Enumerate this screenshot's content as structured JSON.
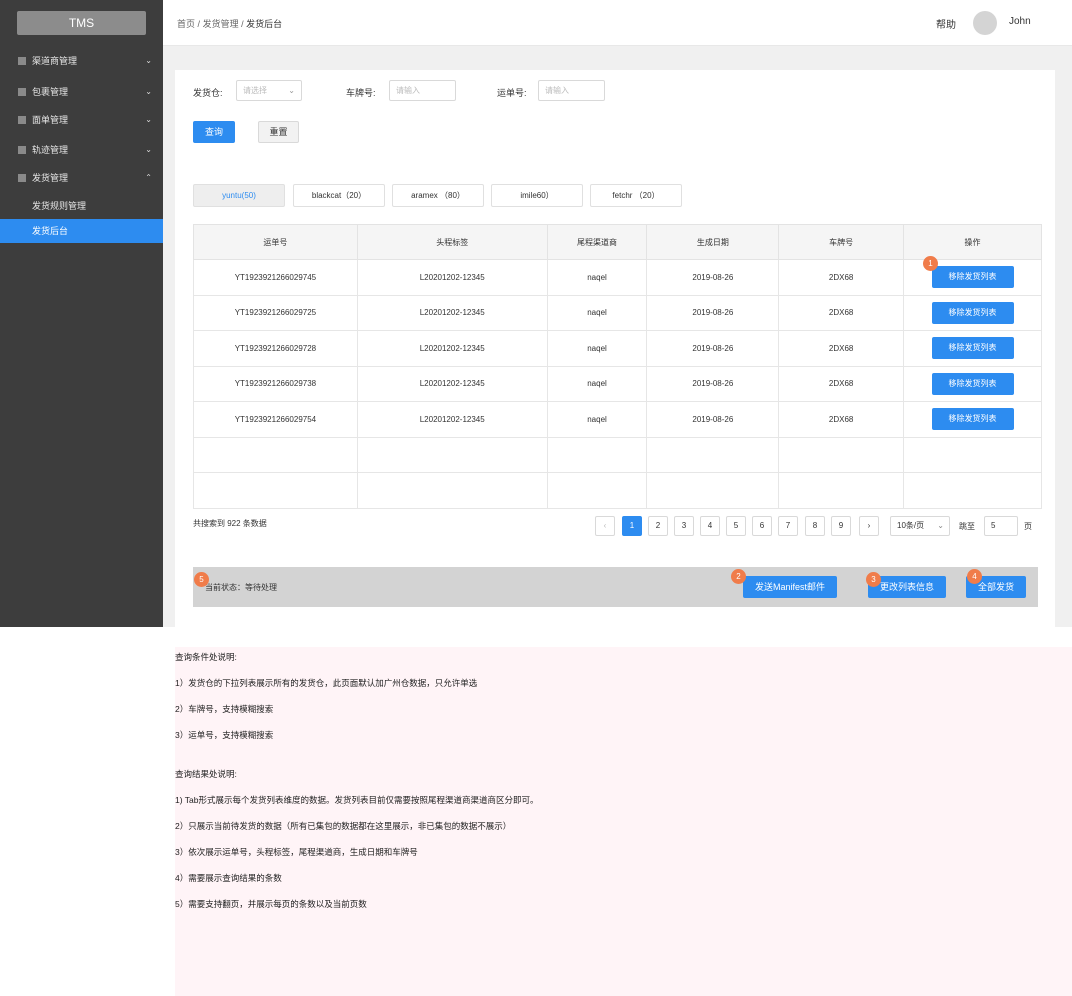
{
  "app": {
    "logo": "TMS"
  },
  "sidebar": {
    "menus": [
      {
        "label": "渠道商管理",
        "chevron": "⌄"
      },
      {
        "label": "包裹管理",
        "chevron": "⌄"
      },
      {
        "label": "面单管理",
        "chevron": "⌄"
      },
      {
        "label": "轨迹管理",
        "chevron": "⌄"
      },
      {
        "label": "发货管理",
        "chevron": "⌃"
      }
    ],
    "sub_items": [
      {
        "label": "发货规则管理"
      },
      {
        "label": "发货后台"
      }
    ]
  },
  "header": {
    "breadcrumb": [
      "首页",
      "/",
      "发货管理",
      "/",
      "发货后台"
    ],
    "help": "帮助",
    "user": "John"
  },
  "filters": {
    "warehouse_label": "发货仓:",
    "warehouse_placeholder": "请选择",
    "plate_label": "车牌号:",
    "plate_placeholder": "请输入",
    "waybill_label": "运单号:",
    "waybill_placeholder": "请输入",
    "query_button": "查询",
    "reset_button": "重置"
  },
  "tabs": [
    "yuntu(50)",
    "blackcat（20）",
    "aramex （80）",
    "imile60）",
    "fetchr （20）"
  ],
  "table": {
    "headers": [
      "运单号",
      "头程标签",
      "尾程渠道商",
      "生成日期",
      "车牌号",
      "操作"
    ],
    "rows": [
      [
        "YT1923921266029745",
        "L20201202-12345",
        "naqel",
        "2019-08-26",
        "2DX68"
      ],
      [
        "YT1923921266029725",
        "L20201202-12345",
        "naqel",
        "2019-08-26",
        "2DX68"
      ],
      [
        "YT1923921266029728",
        "L20201202-12345",
        "naqel",
        "2019-08-26",
        "2DX68"
      ],
      [
        "YT1923921266029738",
        "L20201202-12345",
        "naqel",
        "2019-08-26",
        "2DX68"
      ],
      [
        "YT1923921266029754",
        "L20201202-12345",
        "naqel",
        "2019-08-26",
        "2DX68"
      ]
    ],
    "action_label": "移除发货列表"
  },
  "pagination": {
    "total_text": "共搜索到 922 条数据",
    "prev": "‹",
    "pages": [
      "1",
      "2",
      "3",
      "4",
      "5",
      "6",
      "7",
      "8",
      "9"
    ],
    "current_page": "1",
    "next": "›",
    "page_size": "10条/页",
    "jump_label": "跳至",
    "jump_value": "5",
    "jump_unit": "页"
  },
  "footer": {
    "status_text": "当前状态：等待处理",
    "manifest_button": "发送Manifest邮件",
    "update_button": "更改列表信息",
    "ship_all_button": "全部发货"
  },
  "badges": [
    "1",
    "2",
    "3",
    "4",
    "5"
  ],
  "notes": {
    "query_title": "查询条件处说明:",
    "query_items": [
      "1）发货仓的下拉列表展示所有的发货仓，此页面默认加广州仓数据，只允许单选",
      "2）车牌号，支持模糊搜索",
      "3）运单号，支持模糊搜索"
    ],
    "result_title": "查询结果处说明:",
    "result_items": [
      "1) Tab形式展示每个发货列表维度的数据。发货列表目前仅需要按照尾程渠道商渠道商区分即可。",
      "2）只展示当前待发货的数据（所有已集包的数据都在这里展示，非已集包的数据不展示）",
      "3）依次展示运单号，头程标签，尾程渠道商，生成日期和车牌号",
      "4）需要展示查询结果的条数",
      "5）需要支持翻页，并展示每页的条数以及当前页数"
    ]
  },
  "colors": {
    "primary": "#2d8cf0",
    "sidebar": "#3d3d3d",
    "badge": "#f07c4a",
    "notes_bg": "#fff4f7"
  }
}
